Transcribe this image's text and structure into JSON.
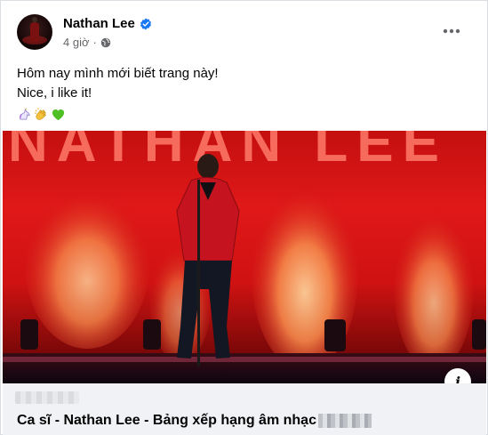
{
  "post": {
    "author": {
      "name": "Nathan Lee",
      "verified": true
    },
    "meta": {
      "time": "4 giờ",
      "separator": "·",
      "privacy_icon": "globe-icon"
    },
    "more_icon": "more-horizontal-icon",
    "caption": {
      "line1": "Hôm nay mình mới biết trang này!",
      "line2": "Nice, i like it!",
      "emojis": [
        "unicorn-emoji",
        "clapping-hands-emoji",
        "green-heart-emoji"
      ]
    },
    "image": {
      "backdrop_text": "NATHAN LEE",
      "info_icon": "info-icon",
      "info_label": "i"
    },
    "link_preview": {
      "title": "Ca sĩ - Nathan Lee - Bảng xếp hạng âm nhạc"
    }
  },
  "colors": {
    "brand_blue": "#1877f2",
    "secondary_text": "#65676b",
    "link_bg": "#f0f2f5",
    "stage_red": "#d01212"
  }
}
